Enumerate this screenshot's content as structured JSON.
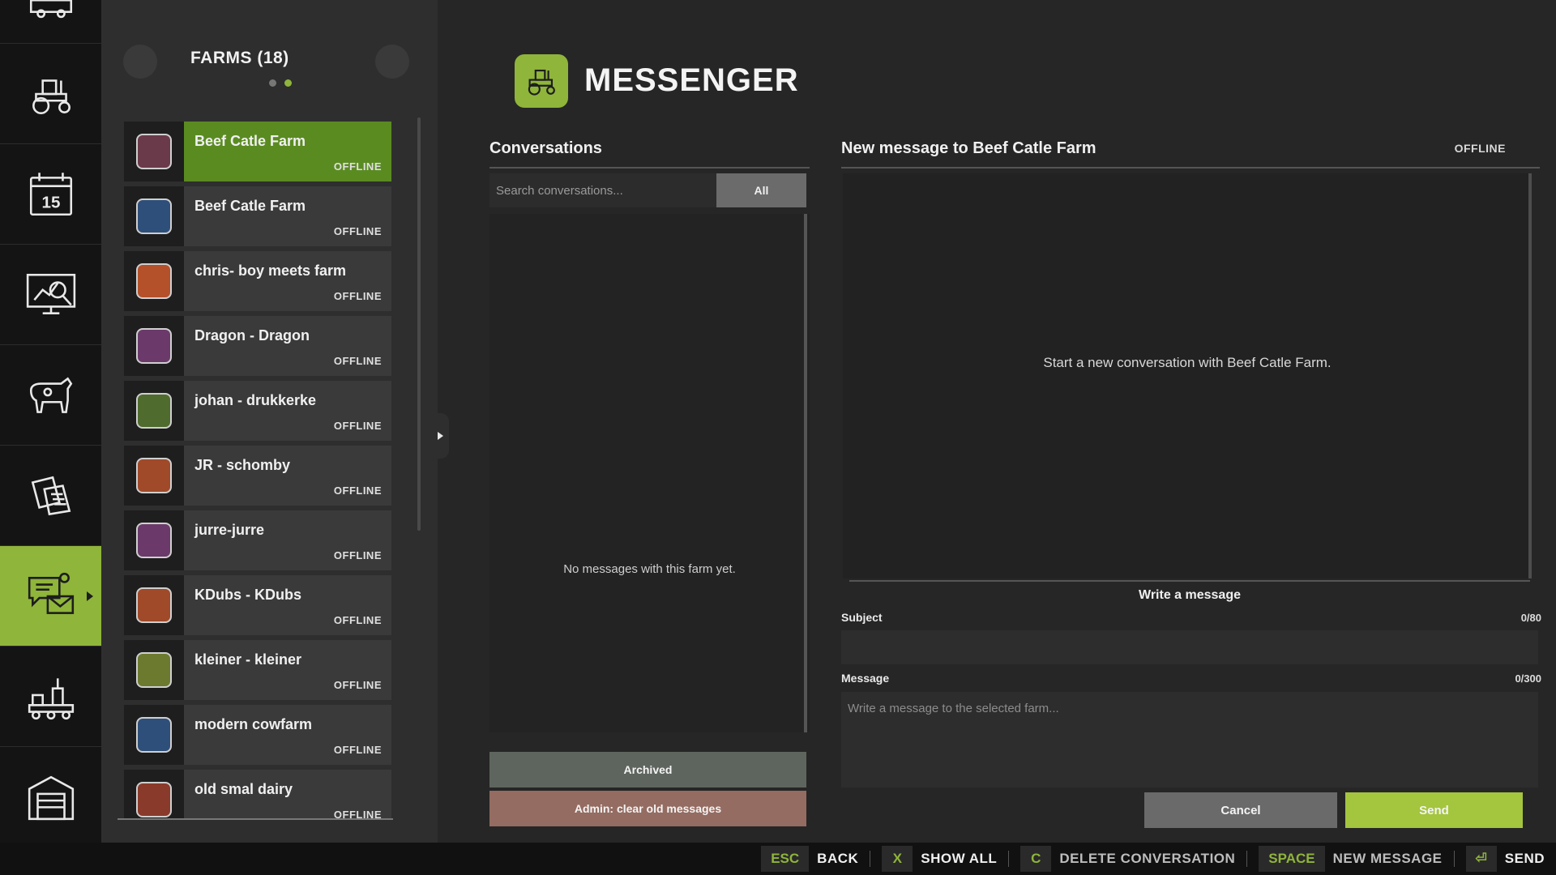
{
  "rail": {
    "items": [
      {
        "name": "rail-item-vehicle-shop",
        "icon": "truck-icon",
        "active": false
      },
      {
        "name": "rail-item-vehicles",
        "icon": "tractor-icon",
        "active": false
      },
      {
        "name": "rail-item-calendar",
        "icon": "calendar-icon",
        "active": false
      },
      {
        "name": "rail-item-statistics",
        "icon": "statistics-icon",
        "active": false
      },
      {
        "name": "rail-item-animals",
        "icon": "cow-icon",
        "active": false
      },
      {
        "name": "rail-item-contracts",
        "icon": "contracts-icon",
        "active": false
      },
      {
        "name": "rail-item-messenger",
        "icon": "messenger-icon",
        "active": true
      },
      {
        "name": "rail-item-production",
        "icon": "production-icon",
        "active": false
      },
      {
        "name": "rail-item-garage",
        "icon": "garage-icon",
        "active": false
      }
    ],
    "calendar_day": "15",
    "accent_color": "#8fb53a"
  },
  "farms": {
    "title": "FARMS (18)",
    "items": [
      {
        "name": "Beef Catle Farm",
        "status": "OFFLINE",
        "selected": true,
        "badge_color": "#6b3a4a"
      },
      {
        "name": "Beef Catle Farm",
        "status": "OFFLINE",
        "selected": false,
        "badge_color": "#2e4f7a"
      },
      {
        "name": "chris- boy meets farm",
        "status": "OFFLINE",
        "selected": false,
        "badge_color": "#b4502a"
      },
      {
        "name": "Dragon - Dragon",
        "status": "OFFLINE",
        "selected": false,
        "badge_color": "#6b3a6b"
      },
      {
        "name": "johan - drukkerke",
        "status": "OFFLINE",
        "selected": false,
        "badge_color": "#4f6b2e"
      },
      {
        "name": "JR - schomby",
        "status": "OFFLINE",
        "selected": false,
        "badge_color": "#a04a2a"
      },
      {
        "name": "jurre-jurre",
        "status": "OFFLINE",
        "selected": false,
        "badge_color": "#6b3a6b"
      },
      {
        "name": "KDubs - KDubs",
        "status": "OFFLINE",
        "selected": false,
        "badge_color": "#a04a2a"
      },
      {
        "name": "kleiner - kleiner",
        "status": "OFFLINE",
        "selected": false,
        "badge_color": "#6b7a2e"
      },
      {
        "name": "modern cowfarm",
        "status": "OFFLINE",
        "selected": false,
        "badge_color": "#2e4f7a"
      },
      {
        "name": "old smal dairy",
        "status": "OFFLINE",
        "selected": false,
        "badge_color": "#8a3a2a"
      }
    ]
  },
  "header": {
    "title": "MESSENGER",
    "icon": "tractor-icon"
  },
  "conversations": {
    "heading": "Conversations",
    "search_placeholder": "Search conversations...",
    "filter_label": "All",
    "empty_text": "No messages with this farm yet.",
    "archived_label": "Archived",
    "admin_label": "Admin: clear old messages"
  },
  "message": {
    "heading": "New message to Beef Catle Farm",
    "status": "OFFLINE",
    "empty_text": "Start a new conversation with Beef Catle Farm.",
    "compose_title": "Write a message",
    "subject_label": "Subject",
    "subject_count": "0/80",
    "subject_value": "",
    "message_label": "Message",
    "message_count": "0/300",
    "message_placeholder": "Write a message to the selected farm...",
    "cancel_label": "Cancel",
    "send_label": "Send"
  },
  "footer": {
    "hints": [
      {
        "key": "ESC",
        "action": "BACK"
      },
      {
        "key": "X",
        "action": "SHOW ALL"
      },
      {
        "key": "C",
        "action": "DELETE CONVERSATION",
        "dim": true
      },
      {
        "key": "SPACE",
        "action": "NEW MESSAGE",
        "dim": true
      },
      {
        "key": "⏎",
        "action": "SEND"
      }
    ]
  }
}
